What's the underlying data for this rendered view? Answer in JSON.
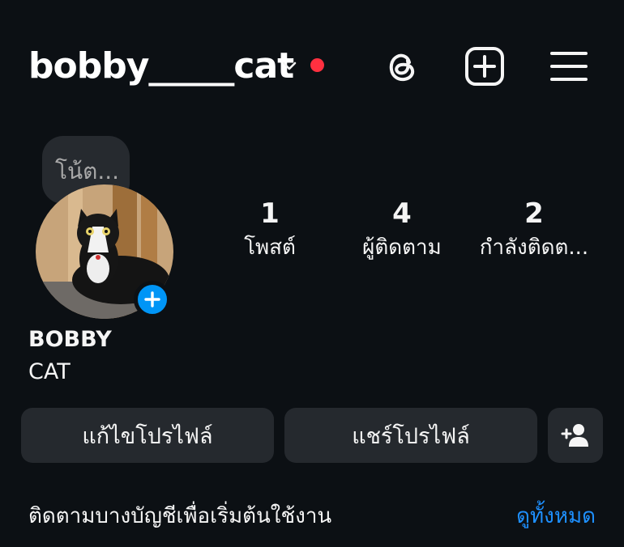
{
  "header": {
    "username": "bobby_____cat",
    "has_notification": true,
    "accent_color": "#ff3040",
    "icons": [
      "chevron-down-icon",
      "threads-icon",
      "create-post-icon",
      "menu-icon"
    ]
  },
  "profile": {
    "note": "โน้ต...",
    "avatar_alt": "avatar",
    "stats": [
      {
        "value": "1",
        "label": "โพสต์"
      },
      {
        "value": "4",
        "label": "ผู้ติดตาม"
      },
      {
        "value": "2",
        "label": "กำลังติดต..."
      }
    ],
    "display_name_line1": "BOBBY",
    "display_name_line2": "CAT"
  },
  "actions": {
    "edit_profile": "แก้ไขโปรไฟล์",
    "share_profile": "แชร์โปรไฟล์",
    "add_person_icon": "add-person-icon"
  },
  "suggestions": {
    "prompt": "ติดตามบางบัญชีเพื่อเริ่มต้นใช้งาน",
    "see_all": "ดูทั้งหมด",
    "link_color": "#1e90ff"
  }
}
